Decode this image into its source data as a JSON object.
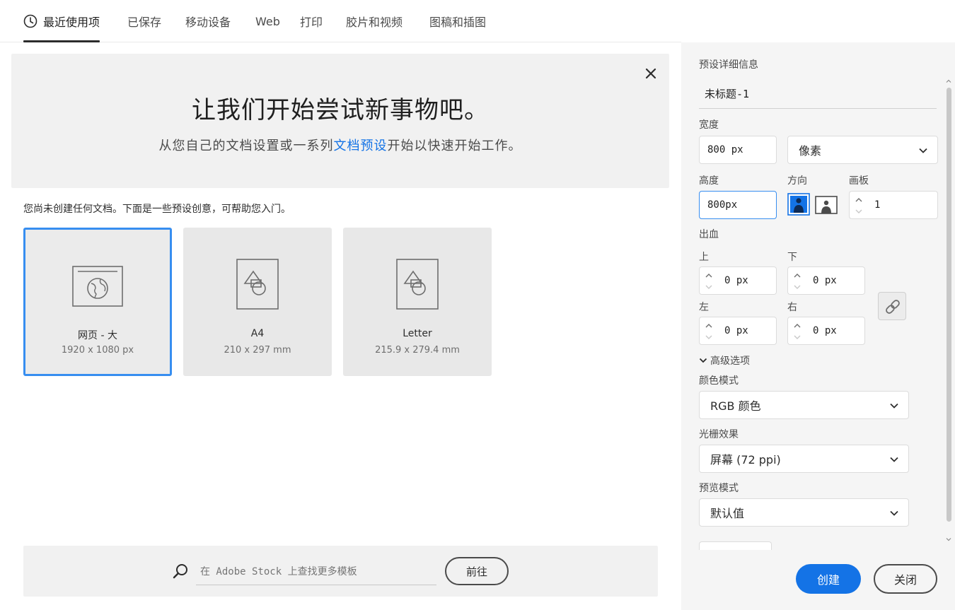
{
  "tabs": [
    {
      "label": "最近使用项",
      "icon": "clock-icon",
      "active": true
    },
    {
      "label": "已保存"
    },
    {
      "label": "移动设备"
    },
    {
      "label": "Web"
    },
    {
      "label": "打印"
    },
    {
      "label": "胶片和视频"
    },
    {
      "label": "图稿和插图"
    }
  ],
  "hero": {
    "title": "让我们开始尝试新事物吧。",
    "subtitle_before": "从您自己的文档设置或一系列",
    "subtitle_link": "文档预设",
    "subtitle_after": "开始以快速开始工作。"
  },
  "intro_text": "您尚未创建任何文档。下面是一些预设创意，可帮助您入门。",
  "presets": [
    {
      "name": "网页 - 大",
      "size": "1920 x 1080 px",
      "icon": "web-globe-icon",
      "selected": true
    },
    {
      "name": "A4",
      "size": "210 x 297 mm",
      "icon": "document-shapes-icon"
    },
    {
      "name": "Letter",
      "size": "215.9 x 279.4 mm",
      "icon": "document-shapes-icon"
    }
  ],
  "stock": {
    "placeholder": "在 Adobe Stock 上查找更多模板",
    "go_label": "前往"
  },
  "panel": {
    "section_title": "预设详细信息",
    "doc_name": "未标题-1",
    "width_label": "宽度",
    "width_value": "800 px",
    "units": "像素",
    "height_label": "高度",
    "height_value": "800px",
    "orientation_label": "方向",
    "artboards_label": "画板",
    "artboards_value": "1",
    "bleed_label": "出血",
    "top_label": "上",
    "top_value": "0 px",
    "bottom_label": "下",
    "bottom_value": "0 px",
    "left_label": "左",
    "left_value": "0 px",
    "right_label": "右",
    "right_value": "0 px",
    "advanced_label": "高级选项",
    "color_mode_label": "颜色模式",
    "color_mode_value": "RGB 颜色",
    "raster_label": "光栅效果",
    "raster_value": "屏幕 (72 ppi)",
    "preview_label": "预览模式",
    "preview_value": "默认值",
    "create_label": "创建",
    "close_label": "关闭"
  },
  "colors": {
    "accent": "#1473e6",
    "selected_border": "#378ef0"
  }
}
